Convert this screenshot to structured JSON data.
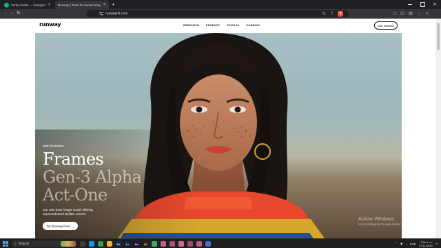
{
  "browser": {
    "tabs": [
      {
        "title": "Verify Codes — SimplyCodes",
        "active": false
      },
      {
        "title": "Runway | Tools for human imagination",
        "active": true
      }
    ],
    "url": "runwayml.com"
  },
  "site": {
    "logo": "runway",
    "nav": [
      "RESEARCH",
      "PRODUCT",
      "STUDIOS",
      "COMPANY"
    ],
    "cta": "Get Started"
  },
  "hero": {
    "eyebrow": "NEW RELEASES",
    "headlines": [
      "Frames",
      "Gen-3 Alpha",
      "Act-One"
    ],
    "description": "Our new base image model offering unprecedented stylistic control.",
    "button": "Try Runway Now",
    "button_arrow": "→"
  },
  "watermark": {
    "title": "Activar Windows",
    "subtitle": "Ve a Configuración para activar Windows."
  },
  "taskbar": {
    "search_placeholder": "Buscar",
    "apps": [
      {
        "name": "task-view",
        "label": "",
        "color": "#3a3a3a"
      },
      {
        "name": "edge",
        "label": "",
        "color": "#1b8fd8"
      },
      {
        "name": "chrome",
        "label": "",
        "color": "#2f9e44"
      },
      {
        "name": "file-explorer",
        "label": "",
        "color": "#e8b53a"
      },
      {
        "name": "photoshop",
        "label": "Ps",
        "color": "#0f2d4f"
      },
      {
        "name": "lightroom",
        "label": "Lr",
        "color": "#0d2a45"
      },
      {
        "name": "after-effects",
        "label": "Ae",
        "color": "#27144a"
      },
      {
        "name": "illustrator",
        "label": "Ai",
        "color": "#3b1d0e"
      },
      {
        "name": "app-green",
        "label": "",
        "color": "#39a96b"
      },
      {
        "name": "app-pink-1",
        "label": "",
        "color": "#c75a8e"
      },
      {
        "name": "app-pink-2",
        "label": "",
        "color": "#b54a7a"
      },
      {
        "name": "app-pink-3",
        "label": "",
        "color": "#d0699c"
      },
      {
        "name": "app-pink-4",
        "label": "",
        "color": "#a8456f"
      },
      {
        "name": "app-pink-5",
        "label": "",
        "color": "#c4578a"
      },
      {
        "name": "app-blue",
        "label": "",
        "color": "#3f6ec9"
      }
    ],
    "tray_language": "ESP",
    "time": "7:08 a. m.",
    "date": "27/11/2024"
  }
}
